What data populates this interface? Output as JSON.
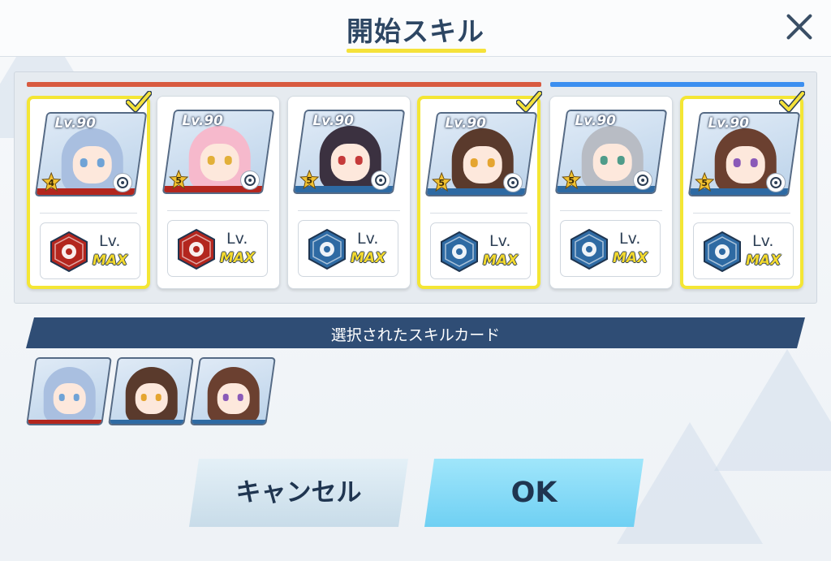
{
  "dialog": {
    "title": "開始スキル",
    "close_icon": "close-icon"
  },
  "colors": {
    "team_red": "#d85a40",
    "team_blue": "#3c8ff0",
    "selected_border": "#f4e634",
    "title_underline": "#f5e23a",
    "banner": "#2f4d75",
    "ok_button": "#7fd8f5",
    "cancel_button": "#d6e6f0"
  },
  "cards": [
    {
      "level": "Lv.90",
      "stars": "4",
      "role_icon": "support-icon",
      "skill_icon": "gun-up-icon",
      "skill_color": "#b3261e",
      "skill_lv": "Lv.",
      "skill_max": "MAX",
      "selected": true,
      "hair": "#a9bfe0",
      "eye": "#6fa3d6",
      "strip": "#b3261e"
    },
    {
      "level": "Lv.90",
      "stars": "5",
      "role_icon": "support-icon",
      "skill_icon": "explosion-icon",
      "skill_color": "#b3261e",
      "skill_lv": "Lv.",
      "skill_max": "MAX",
      "selected": false,
      "hair": "#f6b9cc",
      "eye": "#e2b03a",
      "strip": "#b3261e"
    },
    {
      "level": "Lv.90",
      "stars": "5",
      "role_icon": "target-icon",
      "skill_icon": "flower-icon",
      "skill_color": "#2e6aa3",
      "skill_lv": "Lv.",
      "skill_max": "MAX",
      "selected": false,
      "hair": "#3b3140",
      "eye": "#c53a3a",
      "strip": "#2e6aa3"
    },
    {
      "level": "Lv.90",
      "stars": "5",
      "role_icon": "target-icon",
      "skill_icon": "crosshair-icon",
      "skill_color": "#2e6aa3",
      "skill_lv": "Lv.",
      "skill_max": "MAX",
      "selected": true,
      "hair": "#5a3a2c",
      "eye": "#e5a530",
      "strip": "#2e6aa3"
    },
    {
      "level": "Lv.90",
      "stars": "5",
      "role_icon": "target-icon",
      "skill_icon": "person-down-icon",
      "skill_color": "#2e6aa3",
      "skill_lv": "Lv.",
      "skill_max": "MAX",
      "selected": false,
      "hair": "#b8bcc4",
      "eye": "#4f9c8a",
      "strip": "#2e6aa3"
    },
    {
      "level": "Lv.90",
      "stars": "5",
      "role_icon": "support-icon",
      "skill_icon": "chest-icon",
      "skill_color": "#2e6aa3",
      "skill_lv": "Lv.",
      "skill_max": "MAX",
      "selected": true,
      "hair": "#6b4030",
      "eye": "#8a5ab8",
      "strip": "#2e6aa3"
    }
  ],
  "selected_section": {
    "label": "選択されたスキルカード",
    "cards": [
      {
        "hair": "#a9bfe0",
        "eye": "#6fa3d6",
        "strip": "#b3261e"
      },
      {
        "hair": "#5a3a2c",
        "eye": "#e5a530",
        "strip": "#2e6aa3"
      },
      {
        "hair": "#6b4030",
        "eye": "#8a5ab8",
        "strip": "#2e6aa3"
      }
    ]
  },
  "buttons": {
    "cancel_label": "キャンセル",
    "ok_label": "OK"
  }
}
